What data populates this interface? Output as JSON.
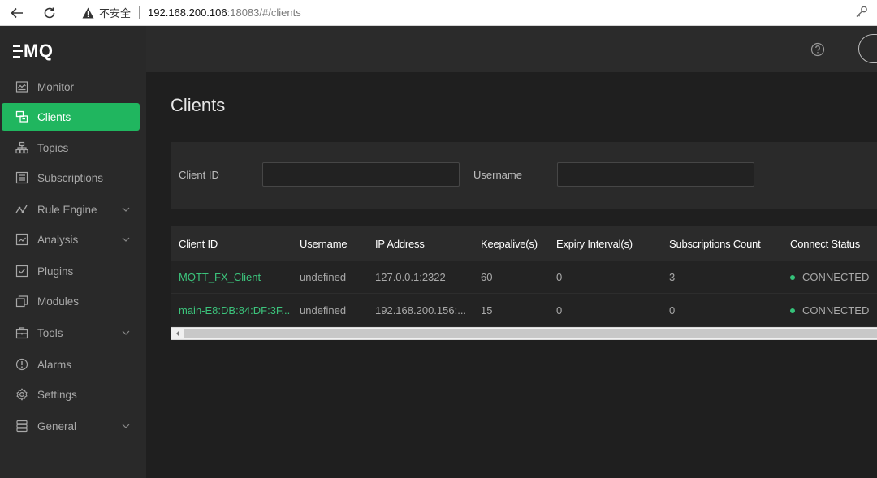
{
  "browser": {
    "insecure_label": "不安全",
    "url_host": "192.168.200.106",
    "url_rest": ":18083/#/clients"
  },
  "brand": {
    "logo_text": "MQ"
  },
  "sidebar": {
    "items": [
      {
        "label": "Monitor",
        "icon": "monitor-icon"
      },
      {
        "label": "Clients",
        "icon": "clients-icon",
        "active": true
      },
      {
        "label": "Topics",
        "icon": "topics-icon"
      },
      {
        "label": "Subscriptions",
        "icon": "subscriptions-icon"
      },
      {
        "label": "Rule Engine",
        "icon": "rule-engine-icon",
        "expandable": true
      },
      {
        "label": "Analysis",
        "icon": "analysis-icon",
        "expandable": true
      },
      {
        "label": "Plugins",
        "icon": "plugins-icon"
      },
      {
        "label": "Modules",
        "icon": "modules-icon"
      },
      {
        "label": "Tools",
        "icon": "tools-icon",
        "expandable": true
      },
      {
        "label": "Alarms",
        "icon": "alarms-icon"
      },
      {
        "label": "Settings",
        "icon": "settings-icon"
      },
      {
        "label": "General",
        "icon": "general-icon",
        "expandable": true
      }
    ]
  },
  "page": {
    "title": "Clients"
  },
  "filter": {
    "client_id_label": "Client ID",
    "client_id_value": "",
    "username_label": "Username",
    "username_value": ""
  },
  "table": {
    "headers": [
      "Client ID",
      "Username",
      "IP Address",
      "Keepalive(s)",
      "Expiry Interval(s)",
      "Subscriptions Count",
      "Connect Status"
    ],
    "rows": [
      {
        "client_id": "MQTT_FX_Client",
        "username": "undefined",
        "ip": "127.0.0.1:2322",
        "keepalive": "60",
        "expiry": "0",
        "subs": "3",
        "status": "CONNECTED"
      },
      {
        "client_id": "main-E8:DB:84:DF:3F...",
        "username": "undefined",
        "ip": "192.168.200.156:...",
        "keepalive": "15",
        "expiry": "0",
        "subs": "0",
        "status": "CONNECTED"
      }
    ]
  },
  "colors": {
    "accent": "#20b65f",
    "link": "#3cc47c",
    "status_connected": "#35c27a"
  }
}
